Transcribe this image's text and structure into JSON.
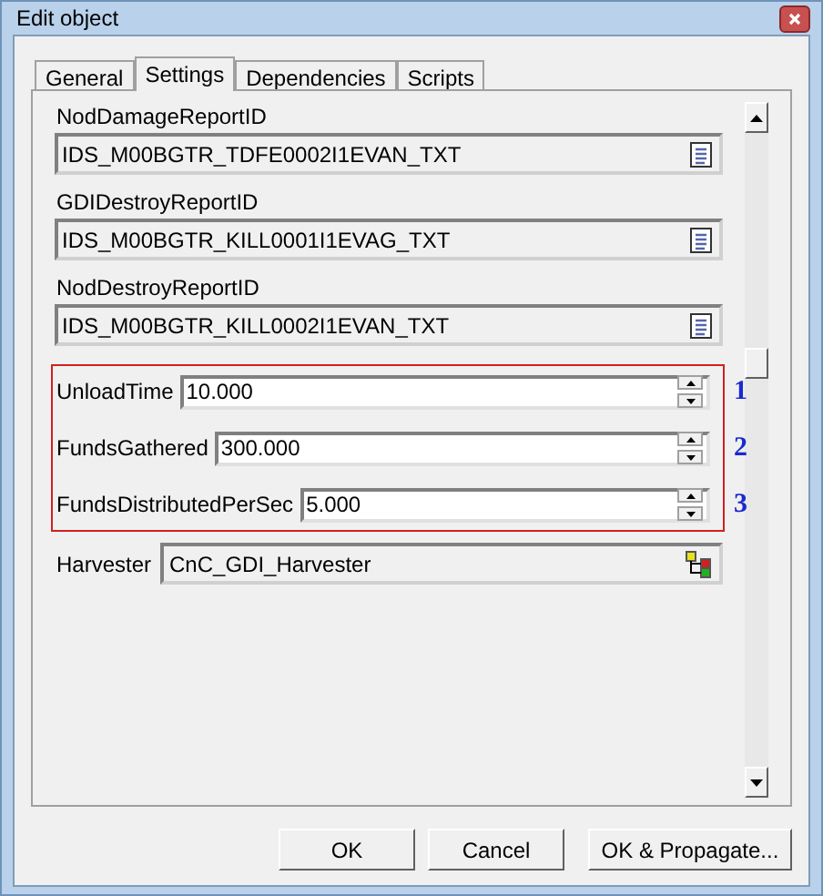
{
  "window": {
    "title": "Edit object"
  },
  "tabs": [
    {
      "label": "General",
      "selected": false
    },
    {
      "label": "Settings",
      "selected": true
    },
    {
      "label": "Dependencies",
      "selected": false
    },
    {
      "label": "Scripts",
      "selected": false
    }
  ],
  "string_fields": [
    {
      "label": "NodDamageReportID",
      "value": "IDS_M00BGTR_TDFE0002I1EVAN_TXT"
    },
    {
      "label": "GDIDestroyReportID",
      "value": "IDS_M00BGTR_KILL0001I1EVAG_TXT"
    },
    {
      "label": "NodDestroyReportID",
      "value": "IDS_M00BGTR_KILL0002I1EVAN_TXT"
    }
  ],
  "number_fields": [
    {
      "label": "UnloadTime",
      "value": "10.000",
      "marker": "1"
    },
    {
      "label": "FundsGathered",
      "value": "300.000",
      "marker": "2"
    },
    {
      "label": "FundsDistributedPerSec",
      "value": "5.000",
      "marker": "3"
    }
  ],
  "harvester": {
    "label": "Harvester",
    "value": "CnC_GDI_Harvester"
  },
  "buttons": [
    "OK",
    "Cancel",
    "OK & Propagate..."
  ]
}
